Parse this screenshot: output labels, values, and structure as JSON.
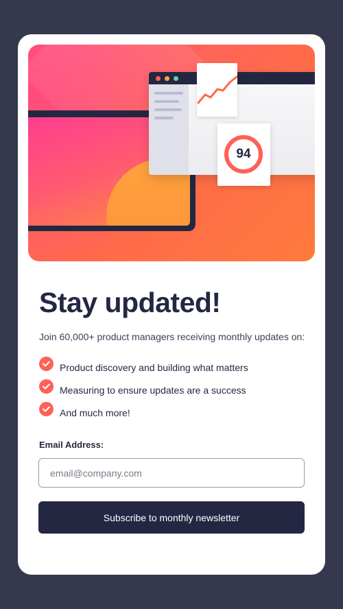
{
  "hero": {
    "score": "94",
    "colors": {
      "accent": "#ff6155",
      "dark": "#242742",
      "page_bg": "#36384d"
    }
  },
  "content": {
    "title": "Stay updated!",
    "subtitle": "Join 60,000+ product managers receiving monthly updates on:",
    "features": [
      {
        "label": "Product discovery and building what matters",
        "icon": "check-icon"
      },
      {
        "label": "Measuring to ensure updates are a success",
        "icon": "check-icon"
      },
      {
        "label": "And much more!",
        "icon": "check-icon"
      }
    ]
  },
  "form": {
    "email_label": "Email Address:",
    "email_placeholder": "email@company.com",
    "email_value": "",
    "submit_label": "Subscribe to monthly newsletter"
  }
}
